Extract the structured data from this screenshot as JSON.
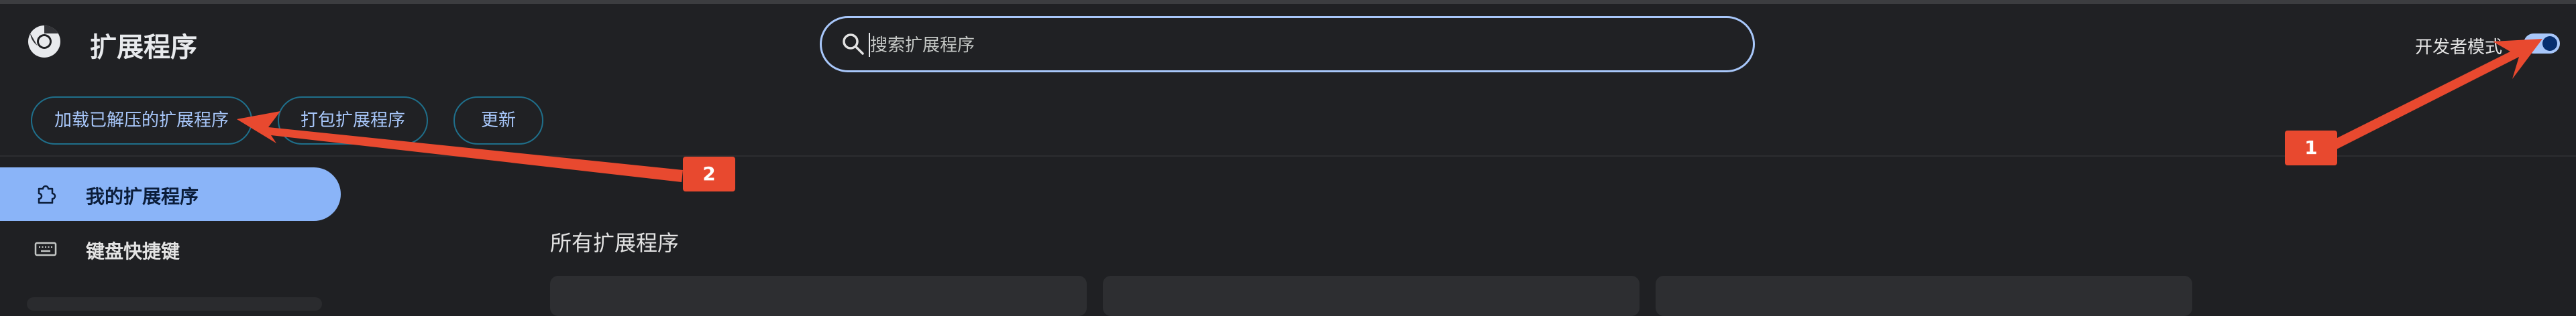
{
  "header": {
    "title": "扩展程序",
    "logo_icon": "chrome-logo-icon",
    "search": {
      "placeholder": "搜索扩展程序",
      "value": ""
    },
    "developer_mode": {
      "label": "开发者模式",
      "enabled": true
    }
  },
  "toolbar": {
    "load_unpacked_label": "加载已解压的扩展程序",
    "pack_label": "打包扩展程序",
    "update_label": "更新"
  },
  "sidebar": {
    "items": [
      {
        "label": "我的扩展程序",
        "icon": "puzzle-icon",
        "active": true
      },
      {
        "label": "键盘快捷键",
        "icon": "keyboard-icon",
        "active": false
      }
    ]
  },
  "main": {
    "section_title": "所有扩展程序"
  },
  "annotations": [
    {
      "label": "1"
    },
    {
      "label": "2"
    }
  ],
  "colors": {
    "background": "#1f2023",
    "accent": "#a8c7fa",
    "active_nav": "#8ab4f8",
    "annotation": "#e8492f"
  }
}
